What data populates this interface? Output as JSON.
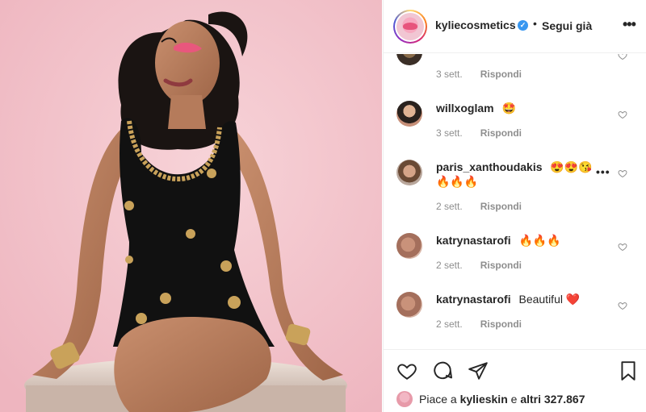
{
  "post": {
    "username": "kyliecosmetics",
    "separator": "•",
    "follow_label": "Segui già",
    "more_label": "•••",
    "verified_glyph": "✓"
  },
  "comments": [
    {
      "username": "",
      "text": "",
      "time": "3 sett.",
      "reply": "Rispondi"
    },
    {
      "username": "willxoglam",
      "text": "🤩",
      "time": "3 sett.",
      "reply": "Rispondi"
    },
    {
      "username": "paris_xanthoudakis",
      "text": "😍😍😘🔥🔥🔥",
      "time": "2 sett.",
      "reply": "Rispondi",
      "more": "•••"
    },
    {
      "username": "katrynastarofi",
      "text": "🔥🔥🔥",
      "time": "2 sett.",
      "reply": "Rispondi"
    },
    {
      "username": "katrynastarofi",
      "text": "Beautiful ❤️",
      "time": "2 sett.",
      "reply": "Rispondi"
    }
  ],
  "likes": {
    "prefix": "Piace a",
    "user": "kylieskin",
    "middle": "e",
    "others": "altri 327.867"
  },
  "icons": {
    "like": "heart-icon",
    "comment": "comment-icon",
    "share": "paper-plane-icon",
    "save": "bookmark-icon",
    "comment_like": "heart-icon"
  },
  "colors": {
    "background_pink": "#f3c4cc",
    "verified_blue": "#3897f0",
    "meta_gray": "#8e8e8e"
  }
}
